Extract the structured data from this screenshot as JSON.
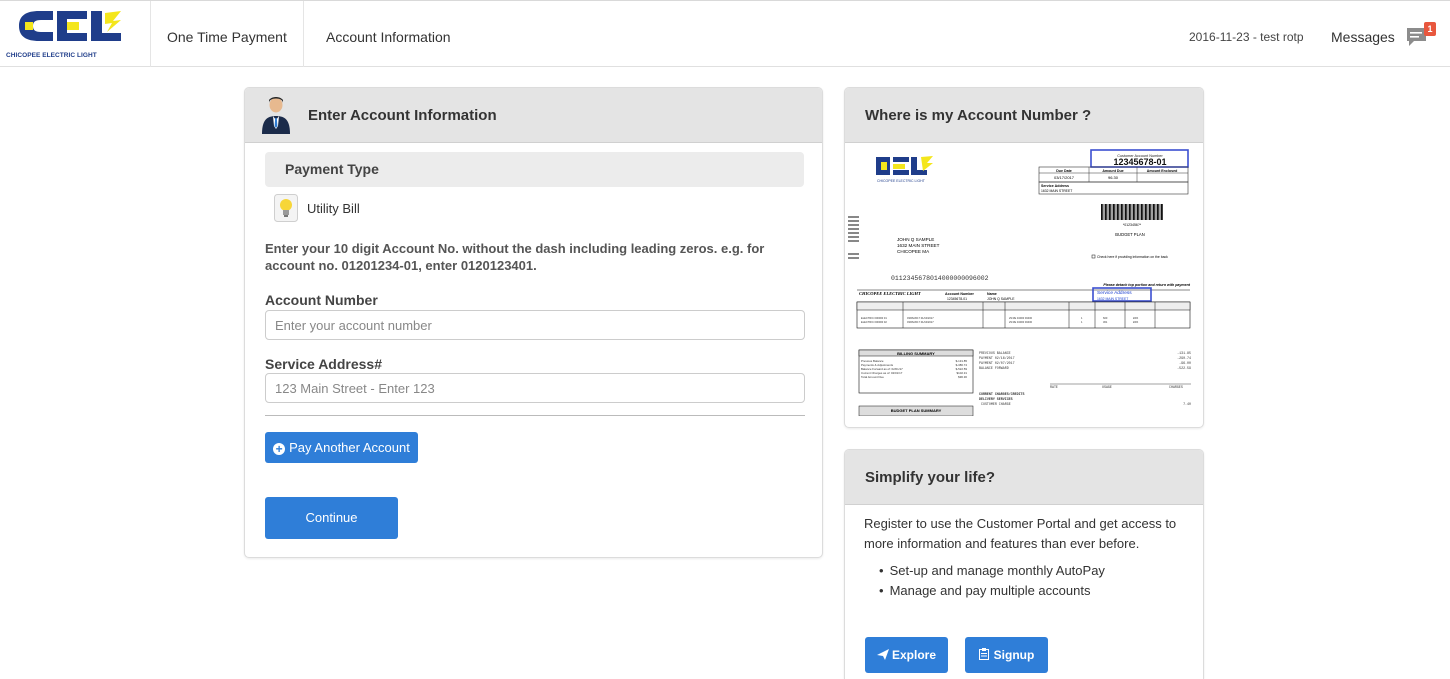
{
  "header": {
    "logo_letters": "CEL",
    "logo_brand": "CHICOPEE ELECTRIC LIGHT",
    "nav": [
      "One Time Payment",
      "Account Information"
    ],
    "date_user": "2016-11-23 - test rotp",
    "messages_label": "Messages",
    "messages_count": "1",
    "icons": [
      "cel-logo",
      "chat-icon"
    ]
  },
  "account_panel": {
    "title": "Enter Account Information",
    "icon": "person-icon",
    "payment_type_label": "Payment Type",
    "payment_type_icon": "lightbulb-icon",
    "payment_type_value": "Utility Bill",
    "instructions": "Enter your 10 digit Account No. without the dash including leading zeros. e.g. for account no. 01201234-01, enter 0120123401.",
    "account_number": {
      "label": "Account Number",
      "placeholder": "Enter your account number",
      "value": ""
    },
    "service_address": {
      "label": "Service Address#",
      "placeholder": "123 Main Street - Enter 123",
      "value": ""
    },
    "pay_another_label": "Pay Another Account",
    "continue_label": "Continue"
  },
  "where_panel": {
    "title": "Where is my Account Number ?",
    "bill": {
      "customer_account_label": "Customer Account Number",
      "customer_account_number": "12345678-01",
      "due_date_label": "Due Date",
      "due_date": "03/17/2017",
      "amount_due_label": "Amount Due",
      "amount_due": "96.30",
      "amount_enclosed_label": "Amount Enclosed",
      "service_address_label": "Service Address",
      "service_address": "1632 MAIN STREET",
      "barcode_text": "*0123456?*",
      "plan": "BUDGET PLAN",
      "customer_name": "JOHN Q SAMPLE",
      "customer_street": "1632 MAIN STREET",
      "customer_city": "CHICOPEE MA",
      "check_note": "Check here if providing information on the back",
      "scanline": "0112345678014000000096002",
      "detach_note": "Please detach top portion and return with payment",
      "stub_company": "CHICOPEE ELECTRIC LIGHT",
      "stub_account_label": "Account Number",
      "stub_account": "12345678-01",
      "stub_name_label": "Name",
      "stub_name": "JOHN Q SAMPLE",
      "stub_service_label": "Service Address",
      "stub_service": "1632 MAIN STREET",
      "billing_summary": "BILLING SUMMARY",
      "previous_balance": "PREVIOUS BALANCE",
      "budget_summary": "BUDGET PLAN SUMMARY",
      "current_charges": "CURRENT CHARGES/CREDITS",
      "delivery_services": "DELIVERY SERVICES",
      "customer_charge": "CUSTOMER CHARGE"
    },
    "highlight_color": "#3b4fd0"
  },
  "simplify_panel": {
    "title": "Simplify your life?",
    "text": "Register to use the Customer Portal and get access to more information and features than ever before.",
    "items": [
      "Set-up and manage monthly AutoPay",
      "Manage and pay multiple accounts"
    ],
    "explore_label": "Explore",
    "signup_label": "Signup"
  },
  "colors": {
    "primary_button": "#2f7ed8",
    "panel_header": "#e4e4e4",
    "brand_yellow": "#f4e61c",
    "brand_blue": "#1f3d8a"
  }
}
